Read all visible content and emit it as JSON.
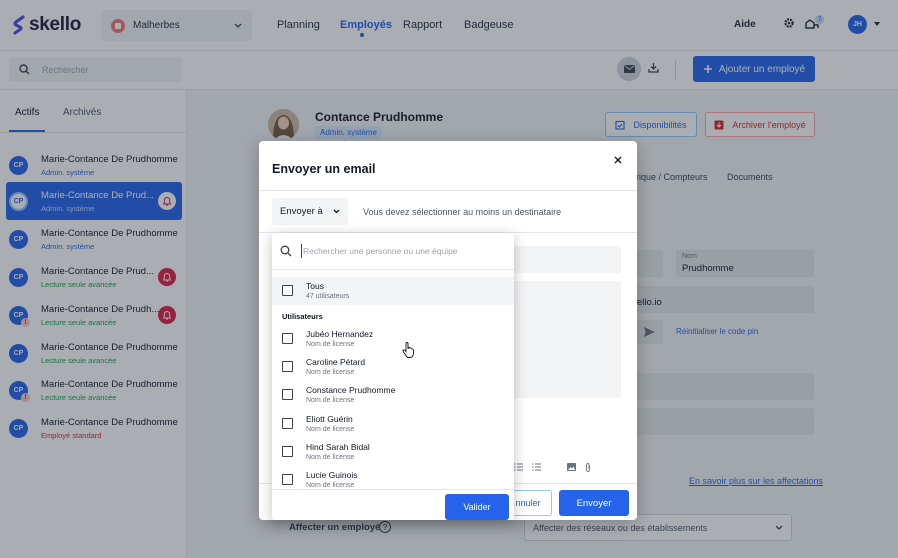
{
  "app": {
    "logo_text": "skello",
    "brand_color": "#2563eb"
  },
  "topbar": {
    "site_label": "Malherbes",
    "nav": [
      "Planning",
      "Employés",
      "Rapport",
      "Badgeuse"
    ],
    "active_nav": "Employés",
    "help_label": "Aide",
    "notification_count": "7",
    "user_initials": "JH"
  },
  "toolbar": {
    "search_placeholder": "Rechercher",
    "add_employee_label": "Ajouter un employé"
  },
  "sidebar": {
    "tabs": [
      "Actifs",
      "Archivés"
    ],
    "active_tab": "Actifs",
    "employees": [
      {
        "initials": "CP",
        "name": "Marie-Contance De Prudhomme",
        "role": "Admin. système",
        "role_color": "#2563eb",
        "selected": false,
        "warning": false,
        "bell": false
      },
      {
        "initials": "CP",
        "name": "Marie-Contance De Prud...",
        "role": "Admin. système",
        "role_color": "#bfdbfe",
        "selected": true,
        "warning": false,
        "bell": true
      },
      {
        "initials": "CP",
        "name": "Marie-Contance De Prudhomme",
        "role": "Admin. système",
        "role_color": "#2563eb",
        "selected": false,
        "warning": false,
        "bell": false
      },
      {
        "initials": "CP",
        "name": "Marie-Contance De Prud...",
        "role": "Lecture seule avancée",
        "role_color": "#16a34a",
        "selected": false,
        "warning": false,
        "bell": true
      },
      {
        "initials": "CP",
        "name": "Marie-Contance De Prudh...",
        "role": "Lecture seule avancée",
        "role_color": "#16a34a",
        "selected": false,
        "warning": true,
        "bell": true
      },
      {
        "initials": "CP",
        "name": "Marie-Contance De Prudhomme",
        "role": "Lecture seule avancée",
        "role_color": "#16a34a",
        "selected": false,
        "warning": false,
        "bell": false
      },
      {
        "initials": "CP",
        "name": "Marie-Contance De Prudhomme",
        "role": "Lecture seule avancée",
        "role_color": "#16a34a",
        "selected": false,
        "warning": true,
        "bell": false
      },
      {
        "initials": "CP",
        "name": "Marie-Contance De Prudhomme",
        "role": "Employé standard",
        "role_color": "#dc2626",
        "selected": false,
        "warning": false,
        "bell": false
      }
    ]
  },
  "profile": {
    "name": "Contance Prudhomme",
    "role": "Admin. système",
    "availability_label": "Disponibilités",
    "archive_label": "Archiver l'employé",
    "tabs": [
      "rique / Compteurs",
      "Documents"
    ],
    "last_name_label": "Nom",
    "last_name_value": "Prudhomme",
    "email_tail": "ello.io",
    "reset_pin_label": "Réinitialiser le code pin",
    "learn_more_label": "En savoir plus sur les affectations",
    "assign_label": "Affecter un employé",
    "assign_placeholder": "Affecter des réseaux ou des établissements"
  },
  "modal": {
    "title": "Envoyer un email",
    "send_to_label": "Envoyer à",
    "recipient_hint": "Vous devez sélectionner au moins un destinataire",
    "cancel_label": "nnuler",
    "send_label": "Envoyer"
  },
  "recipients": {
    "search_placeholder": "Rechercher une personne ou une équipe",
    "all": {
      "name": "Tous",
      "sub": "47 utilisateurs"
    },
    "section_label": "Utilisateurs",
    "users": [
      {
        "name": "Jubéo Hernandez",
        "sub": "Nom de license"
      },
      {
        "name": "Caroline Pétard",
        "sub": "Nom de license"
      },
      {
        "name": "Constance Prudhomme",
        "sub": "Nom de license"
      },
      {
        "name": "Eliott Guérin",
        "sub": "Nom de license"
      },
      {
        "name": "Hind Sarah Bidal",
        "sub": "Nom de license"
      },
      {
        "name": "Lucie Guinois",
        "sub": "Nom de license"
      }
    ],
    "validate_label": "Valider"
  }
}
